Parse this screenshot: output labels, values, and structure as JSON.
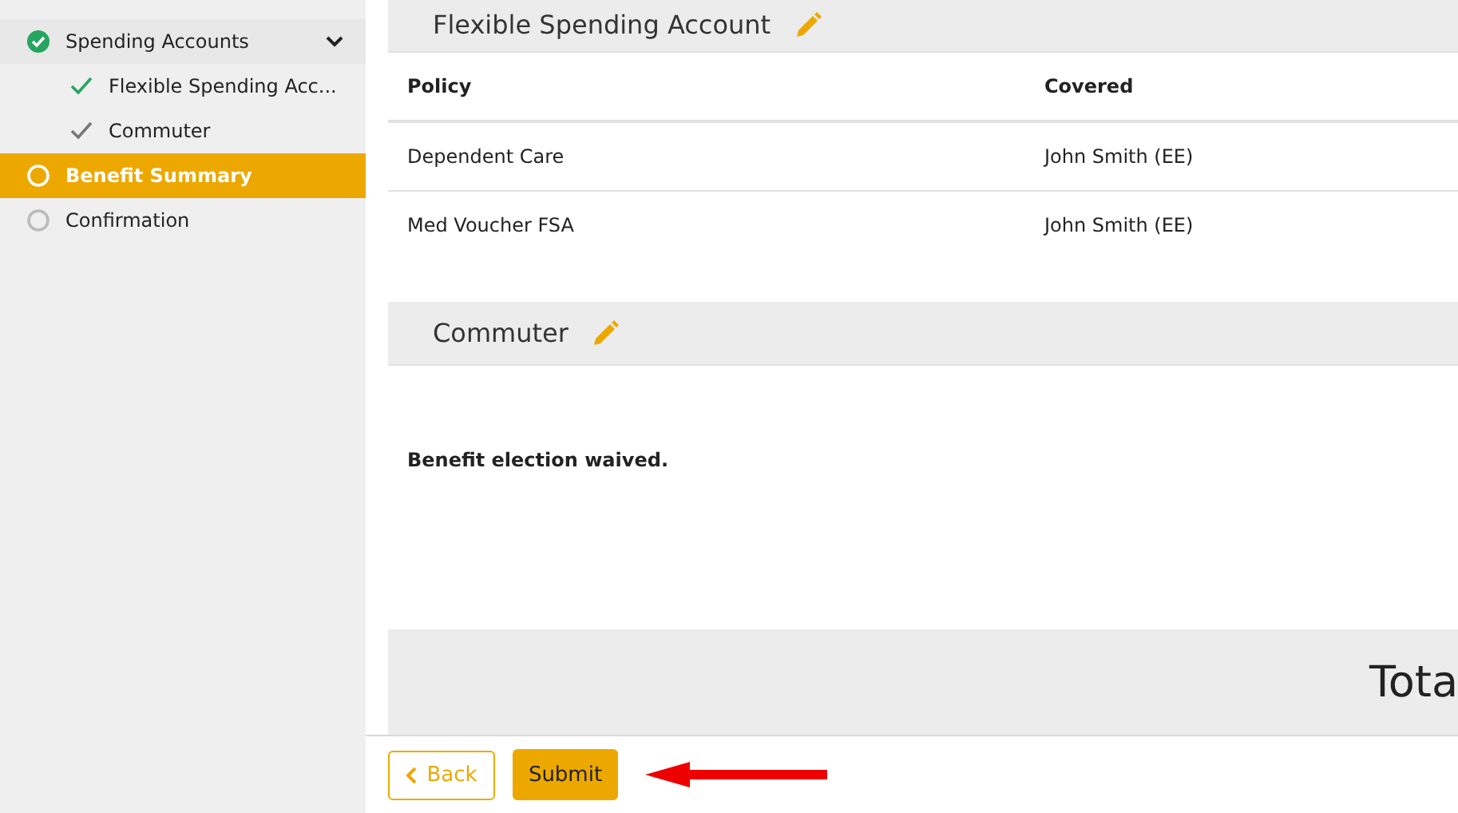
{
  "sidebar": {
    "items": [
      {
        "label": "Spending Accounts",
        "kind": "section",
        "complete": true,
        "selected": false,
        "expanded": true,
        "children": [
          {
            "label": "Flexible Spending Acc...",
            "kind": "sub",
            "checked": true,
            "color": "#25a55f",
            "selected": false
          },
          {
            "label": "Commuter",
            "kind": "sub",
            "checked": true,
            "color": "#777777",
            "selected": false
          }
        ]
      },
      {
        "label": "Benefit Summary",
        "kind": "section",
        "complete": false,
        "selected": true
      },
      {
        "label": "Confirmation",
        "kind": "section",
        "complete": false,
        "selected": false
      }
    ]
  },
  "sections": [
    {
      "title": "Flexible Spending Account",
      "kind": "table",
      "columns": [
        "Policy",
        "Covered"
      ],
      "rows": [
        [
          "Dependent Care",
          "John Smith (EE)"
        ],
        [
          "Med Voucher FSA",
          "John Smith (EE)"
        ]
      ]
    },
    {
      "title": "Commuter",
      "kind": "message",
      "message": "Benefit election waived."
    }
  ],
  "total": {
    "label": "Tota"
  },
  "footer": {
    "back": "Back",
    "submit": "Submit"
  }
}
